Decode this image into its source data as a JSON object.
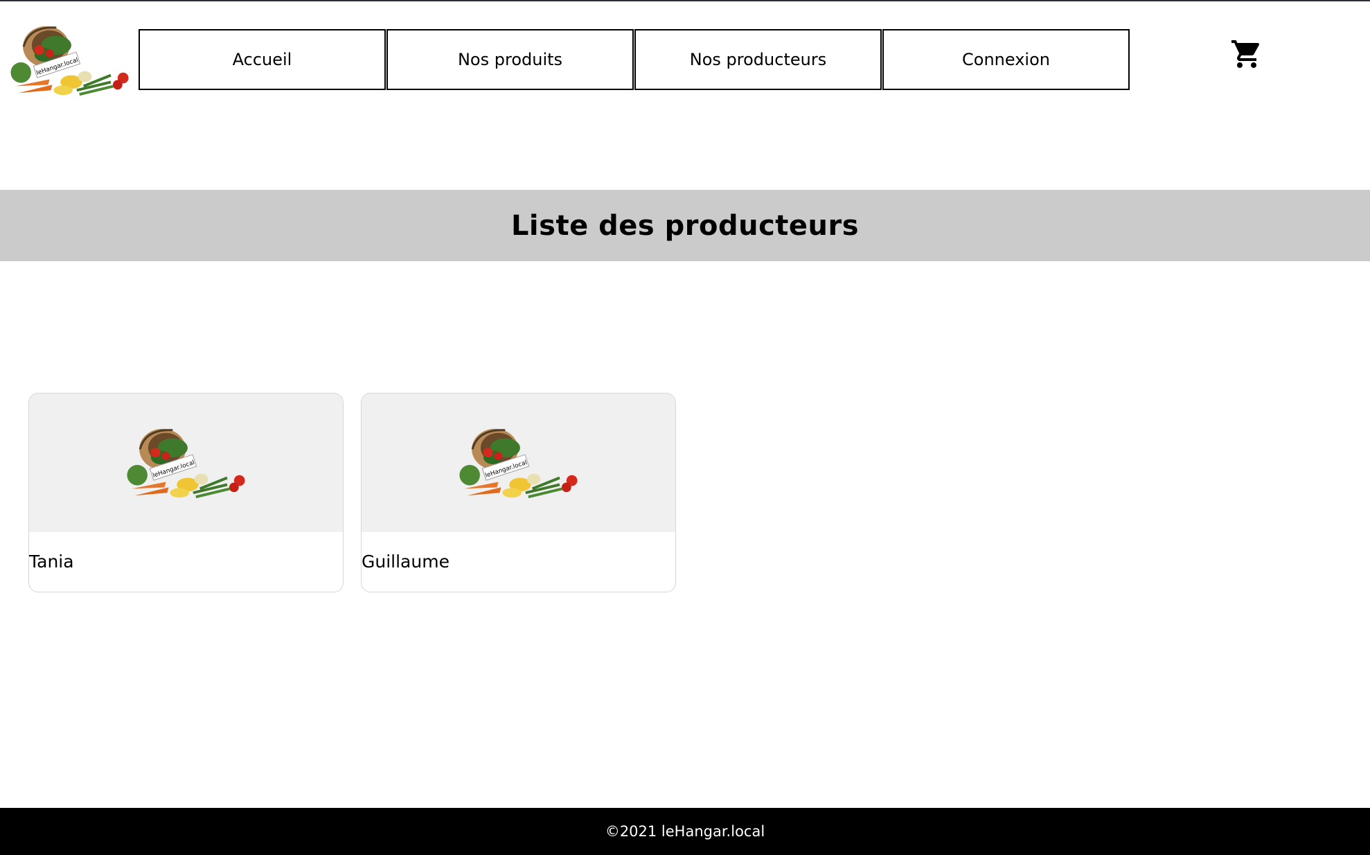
{
  "header": {
    "logo_text": "leHangar.local",
    "nav": [
      {
        "label": "Accueil"
      },
      {
        "label": "Nos produits"
      },
      {
        "label": "Nos producteurs"
      },
      {
        "label": "Connexion"
      }
    ],
    "cart_icon": "shopping-cart-icon"
  },
  "banner": {
    "title": "Liste des producteurs"
  },
  "producers": [
    {
      "name": "Tania",
      "image_logo_text": "leHangar.local"
    },
    {
      "name": "Guillaume",
      "image_logo_text": "leHangar.local"
    }
  ],
  "footer": {
    "copyright": "©2021 leHangar.local"
  },
  "colors": {
    "banner_bg": "#cbcbcb",
    "card_media_bg": "#f0f0f0",
    "footer_bg": "#000000"
  }
}
